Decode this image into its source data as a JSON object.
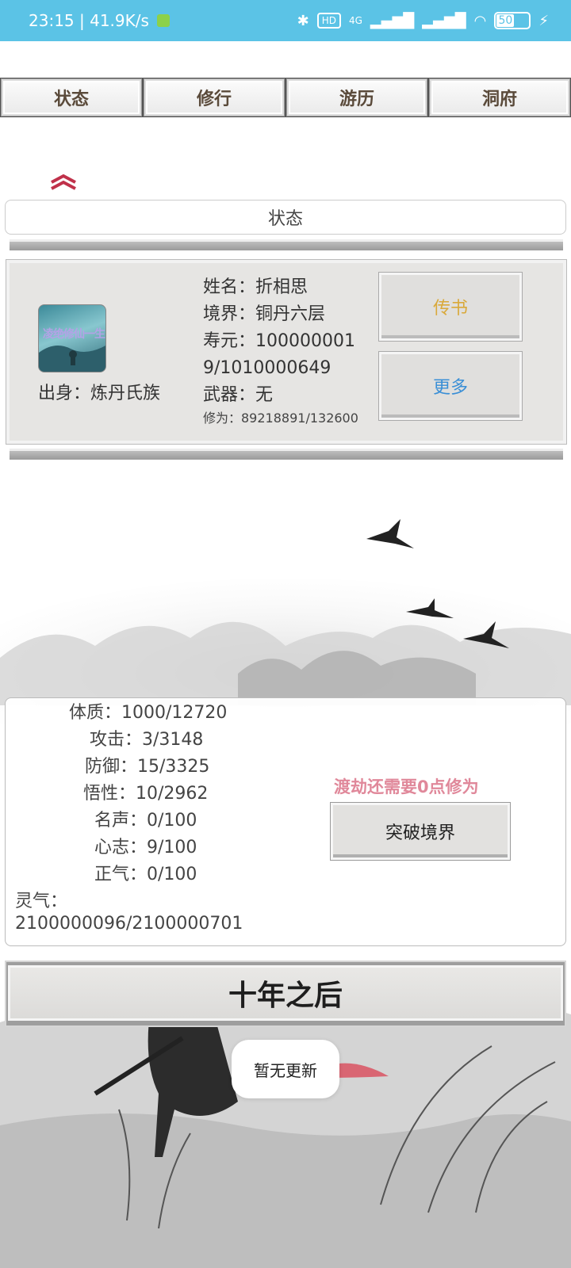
{
  "status_bar": {
    "time_speed": "23:15 | 41.9K/s",
    "hd": "HD",
    "net": "4G",
    "battery": "50"
  },
  "tabs": [
    {
      "label": "状态"
    },
    {
      "label": "修行"
    },
    {
      "label": "游历"
    },
    {
      "label": "洞府"
    }
  ],
  "section_title": "状态",
  "profile": {
    "avatar_text": "凌绝修仙一生",
    "origin": "出身：炼丹氏族",
    "name": "姓名：折相思",
    "realm": "境界：铜丹六层",
    "lifespan_line1": "寿元：100000001",
    "lifespan_line2": "9/1010000649",
    "weapon": "武器：无",
    "cultivation": "修为：89218891/132600",
    "button_letter": "传书",
    "button_more": "更多"
  },
  "stats": {
    "items": [
      "体质：1000/12720",
      "攻击：3/3148",
      "防御：15/3325",
      "悟性：10/2962",
      "名声：0/100",
      "心志：9/100",
      "正气：0/100"
    ],
    "lingqi_label": "灵气：",
    "lingqi_value": "2100000096/2100000701",
    "tribulation_note": "渡劫还需要0点修为",
    "breakthrough_label": "突破境界"
  },
  "decade_button": "十年之后",
  "toast": "暂无更新",
  "colors": {
    "status_bar": "#5bc3e6",
    "letter_btn": "#d9a93a",
    "more_btn": "#3a8fd6",
    "tribulation": "#e0889a",
    "chevron": "#c0314a"
  }
}
